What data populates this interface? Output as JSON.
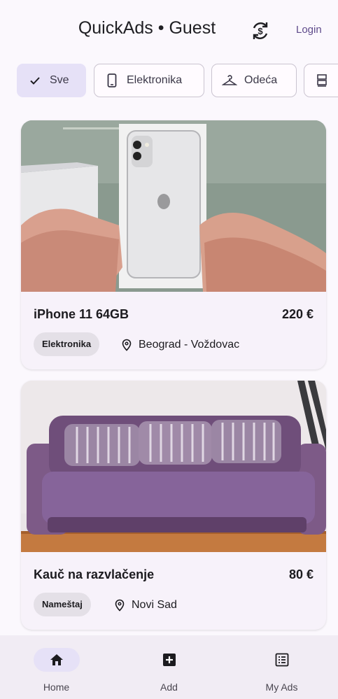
{
  "app": {
    "title": "QuickAds • Guest",
    "login_label": "Login"
  },
  "filters": [
    {
      "label": "Sve",
      "icon": "check-icon",
      "selected": true
    },
    {
      "label": "Elektronika",
      "icon": "phone-icon",
      "selected": false
    },
    {
      "label": "Odeća",
      "icon": "hanger-icon",
      "selected": false
    },
    {
      "label": "",
      "icon": "furniture-icon",
      "selected": false
    }
  ],
  "ads": [
    {
      "title": "iPhone 11 64GB",
      "price": "220 €",
      "category": "Elektronika",
      "location": "Beograd - Voždovac",
      "image": "white-iphone-in-hands"
    },
    {
      "title": "Kauč na razvlačenje",
      "price": "80 €",
      "category": "Nameštaj",
      "location": "Novi Sad",
      "image": "purple-sofa"
    }
  ],
  "nav": [
    {
      "label": "Home",
      "icon": "home-icon",
      "active": true
    },
    {
      "label": "Add",
      "icon": "add-box-icon",
      "active": false
    },
    {
      "label": "My Ads",
      "icon": "list-icon",
      "active": false
    }
  ],
  "colors": {
    "background": "#fbf8fd",
    "selected_chip": "#e6e1f7",
    "card": "#f7f2fa",
    "navbar": "#f1ecf4",
    "login": "#5f4b8b"
  }
}
